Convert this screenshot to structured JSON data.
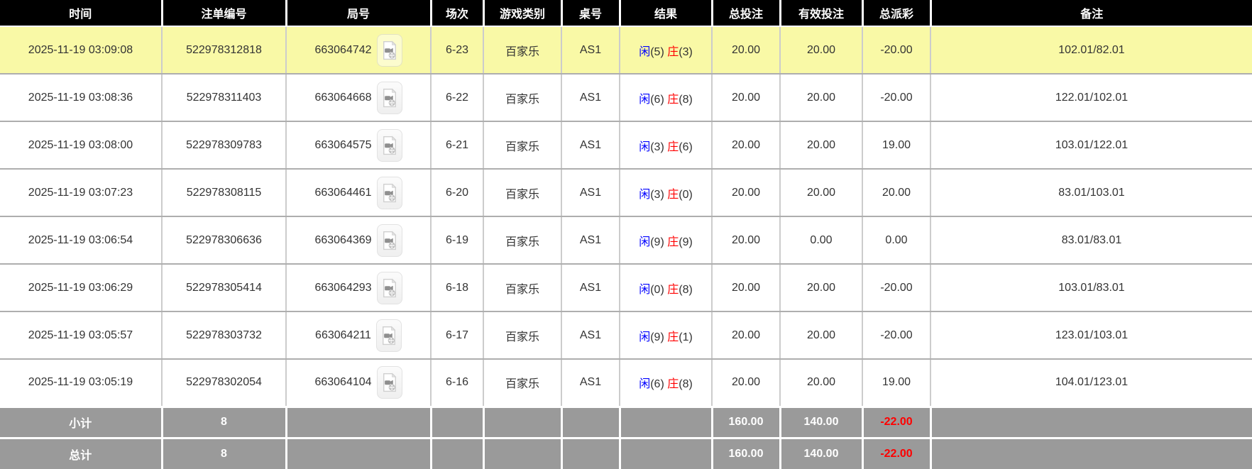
{
  "table": {
    "columns": [
      {
        "key": "time",
        "label": "时间"
      },
      {
        "key": "order_no",
        "label": "注单编号"
      },
      {
        "key": "round_no",
        "label": "局号"
      },
      {
        "key": "session",
        "label": "场次"
      },
      {
        "key": "game_type",
        "label": "游戏类别"
      },
      {
        "key": "table_no",
        "label": "桌号"
      },
      {
        "key": "result",
        "label": "结果"
      },
      {
        "key": "total_bet",
        "label": "总投注"
      },
      {
        "key": "valid_bet",
        "label": "有效投注"
      },
      {
        "key": "total_payout",
        "label": "总派彩"
      },
      {
        "key": "remark",
        "label": "备注"
      }
    ],
    "result_labels": {
      "player": "闲",
      "banker": "庄"
    },
    "icons": {
      "round_cell_icon": "video-replay-icon"
    },
    "rows": [
      {
        "highlighted": true,
        "time": "2025-11-19 03:09:08",
        "order_no": "522978312818",
        "round_no": "663064742",
        "session": "6-23",
        "game_type": "百家乐",
        "table_no": "AS1",
        "player": "5",
        "banker": "3",
        "total_bet": "20.00",
        "valid_bet": "20.00",
        "total_payout": "-20.00",
        "remark": "102.01/82.01"
      },
      {
        "highlighted": false,
        "time": "2025-11-19 03:08:36",
        "order_no": "522978311403",
        "round_no": "663064668",
        "session": "6-22",
        "game_type": "百家乐",
        "table_no": "AS1",
        "player": "6",
        "banker": "8",
        "total_bet": "20.00",
        "valid_bet": "20.00",
        "total_payout": "-20.00",
        "remark": "122.01/102.01"
      },
      {
        "highlighted": false,
        "time": "2025-11-19 03:08:00",
        "order_no": "522978309783",
        "round_no": "663064575",
        "session": "6-21",
        "game_type": "百家乐",
        "table_no": "AS1",
        "player": "3",
        "banker": "6",
        "total_bet": "20.00",
        "valid_bet": "20.00",
        "total_payout": "19.00",
        "remark": "103.01/122.01"
      },
      {
        "highlighted": false,
        "time": "2025-11-19 03:07:23",
        "order_no": "522978308115",
        "round_no": "663064461",
        "session": "6-20",
        "game_type": "百家乐",
        "table_no": "AS1",
        "player": "3",
        "banker": "0",
        "total_bet": "20.00",
        "valid_bet": "20.00",
        "total_payout": "20.00",
        "remark": "83.01/103.01"
      },
      {
        "highlighted": false,
        "time": "2025-11-19 03:06:54",
        "order_no": "522978306636",
        "round_no": "663064369",
        "session": "6-19",
        "game_type": "百家乐",
        "table_no": "AS1",
        "player": "9",
        "banker": "9",
        "total_bet": "20.00",
        "valid_bet": "0.00",
        "total_payout": "0.00",
        "remark": "83.01/83.01"
      },
      {
        "highlighted": false,
        "time": "2025-11-19 03:06:29",
        "order_no": "522978305414",
        "round_no": "663064293",
        "session": "6-18",
        "game_type": "百家乐",
        "table_no": "AS1",
        "player": "0",
        "banker": "8",
        "total_bet": "20.00",
        "valid_bet": "20.00",
        "total_payout": "-20.00",
        "remark": "103.01/83.01"
      },
      {
        "highlighted": false,
        "time": "2025-11-19 03:05:57",
        "order_no": "522978303732",
        "round_no": "663064211",
        "session": "6-17",
        "game_type": "百家乐",
        "table_no": "AS1",
        "player": "9",
        "banker": "1",
        "total_bet": "20.00",
        "valid_bet": "20.00",
        "total_payout": "-20.00",
        "remark": "123.01/103.01"
      },
      {
        "highlighted": false,
        "time": "2025-11-19 03:05:19",
        "order_no": "522978302054",
        "round_no": "663064104",
        "session": "6-16",
        "game_type": "百家乐",
        "table_no": "AS1",
        "player": "6",
        "banker": "8",
        "total_bet": "20.00",
        "valid_bet": "20.00",
        "total_payout": "19.00",
        "remark": "104.01/123.01"
      }
    ],
    "summary": {
      "subtotal": {
        "label": "小计",
        "count": "8",
        "total_bet": "160.00",
        "valid_bet": "140.00",
        "total_payout": "-22.00"
      },
      "grandtotal": {
        "label": "总计",
        "count": "8",
        "total_bet": "160.00",
        "valid_bet": "140.00",
        "total_payout": "-22.00"
      }
    }
  },
  "colors": {
    "header_bg": "#000000",
    "header_text": "#ffffff",
    "highlight_row_bg": "#f9f9a6",
    "summary_row_bg": "#9a9a9a",
    "player_label": "#0000ff",
    "banker_label": "#ff0000",
    "total_bet_value": "#0066ff",
    "negative_value": "#ff0000",
    "grid_line": "#cccccc"
  }
}
